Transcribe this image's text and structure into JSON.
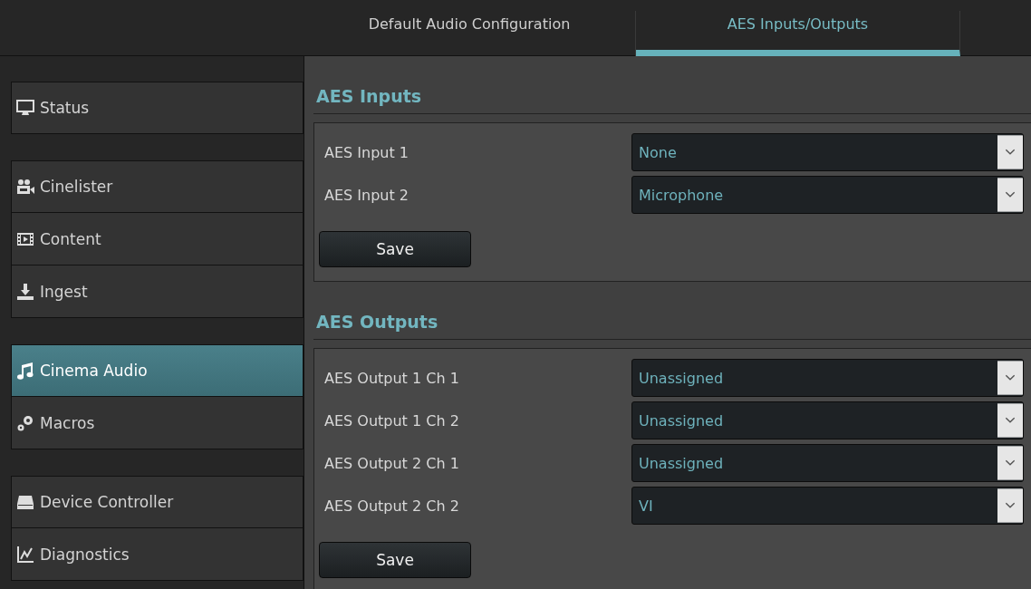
{
  "tabs": [
    {
      "label": "Default Audio Configuration",
      "selected": false
    },
    {
      "label": "AES Inputs/Outputs",
      "selected": true
    }
  ],
  "sidebar": {
    "groups": [
      {
        "items": [
          {
            "label": "Status",
            "selected": false
          }
        ]
      },
      {
        "items": [
          {
            "label": "Cinelister",
            "selected": false
          },
          {
            "label": "Content",
            "selected": false
          },
          {
            "label": "Ingest",
            "selected": false
          }
        ]
      },
      {
        "items": [
          {
            "label": "Cinema Audio",
            "selected": true
          },
          {
            "label": "Macros",
            "selected": false
          }
        ]
      },
      {
        "items": [
          {
            "label": "Device Controller",
            "selected": false
          },
          {
            "label": "Diagnostics",
            "selected": false
          }
        ]
      }
    ]
  },
  "sections": [
    {
      "title": "AES Inputs",
      "fields": [
        {
          "label": "AES Input 1",
          "value": "None"
        },
        {
          "label": "AES Input 2",
          "value": "Microphone"
        }
      ],
      "button": "Save"
    },
    {
      "title": "AES Outputs",
      "fields": [
        {
          "label": "AES Output 1 Ch 1",
          "value": "Unassigned"
        },
        {
          "label": "AES Output 1 Ch 2",
          "value": "Unassigned"
        },
        {
          "label": "AES Output 2 Ch 1",
          "value": "Unassigned"
        },
        {
          "label": "AES Output 2 Ch 2",
          "value": "VI"
        }
      ],
      "button": "Save"
    }
  ]
}
